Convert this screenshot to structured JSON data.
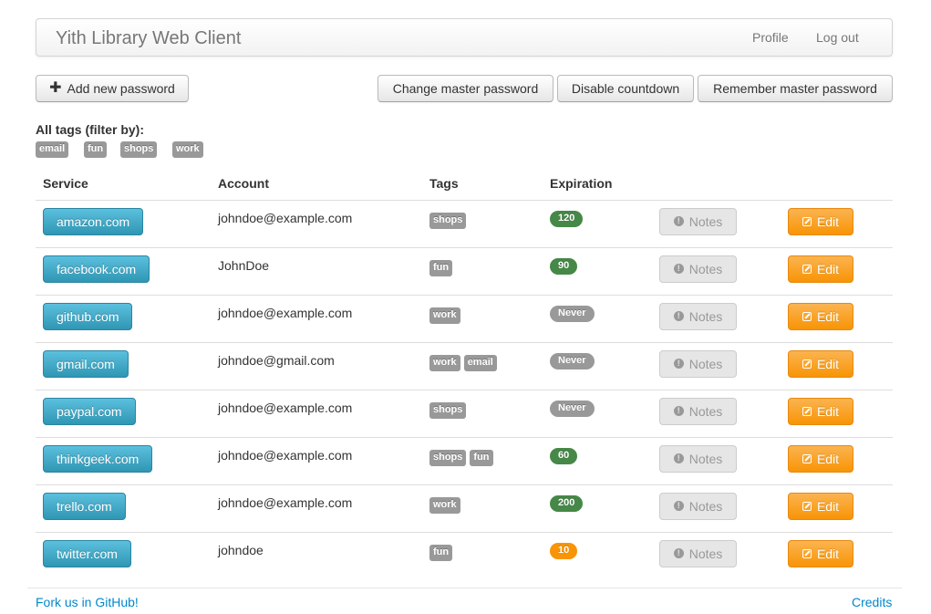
{
  "navbar": {
    "brand": "Yith Library Web Client",
    "links": [
      "Profile",
      "Log out"
    ]
  },
  "toolbar": {
    "add_label": "Add new password",
    "change_master": "Change master password",
    "disable_countdown": "Disable countdown",
    "remember_master": "Remember master password"
  },
  "filter": {
    "title": "All tags (filter by):",
    "tags": [
      "email",
      "fun",
      "shops",
      "work"
    ]
  },
  "table": {
    "headers": [
      "Service",
      "Account",
      "Tags",
      "Expiration"
    ],
    "notes_label": "Notes",
    "edit_label": "Edit",
    "rows": [
      {
        "service": "amazon.com",
        "account": "johndoe@example.com",
        "tags": [
          "shops"
        ],
        "expiration": "120",
        "status": "ok"
      },
      {
        "service": "facebook.com",
        "account": "JohnDoe",
        "tags": [
          "fun"
        ],
        "expiration": "90",
        "status": "ok"
      },
      {
        "service": "github.com",
        "account": "johndoe@example.com",
        "tags": [
          "work"
        ],
        "expiration": "Never",
        "status": "never"
      },
      {
        "service": "gmail.com",
        "account": "johndoe@gmail.com",
        "tags": [
          "work",
          "email"
        ],
        "expiration": "Never",
        "status": "never"
      },
      {
        "service": "paypal.com",
        "account": "johndoe@example.com",
        "tags": [
          "shops"
        ],
        "expiration": "Never",
        "status": "never"
      },
      {
        "service": "thinkgeek.com",
        "account": "johndoe@example.com",
        "tags": [
          "shops",
          "fun"
        ],
        "expiration": "60",
        "status": "ok"
      },
      {
        "service": "trello.com",
        "account": "johndoe@example.com",
        "tags": [
          "work"
        ],
        "expiration": "200",
        "status": "ok"
      },
      {
        "service": "twitter.com",
        "account": "johndoe",
        "tags": [
          "fun"
        ],
        "expiration": "10",
        "status": "warning"
      }
    ]
  },
  "colors": {
    "ok": "#468847",
    "never": "#999999",
    "warning": "#f89406",
    "service": "#49afcd",
    "edit": "#faa732",
    "link": "#0088cc"
  },
  "footer": {
    "github": "Fork us in GitHub!",
    "credits": "Credits"
  }
}
